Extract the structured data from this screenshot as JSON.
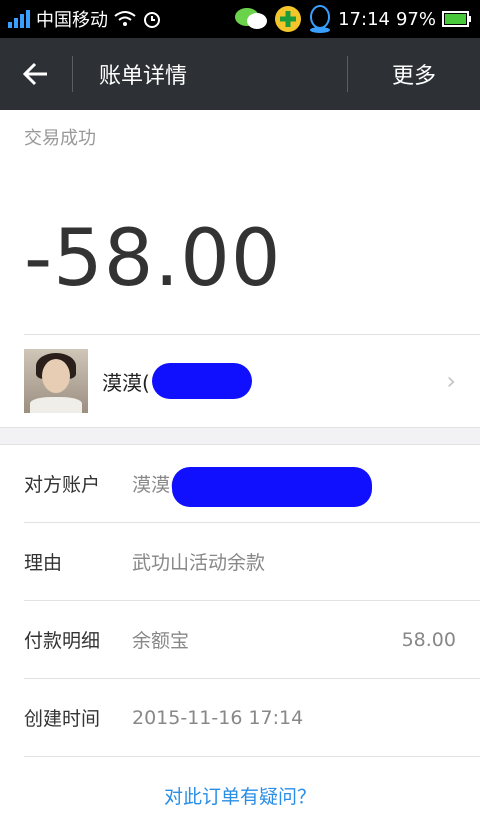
{
  "status_bar": {
    "carrier": "中国移动",
    "time": "17:14",
    "battery": "97%"
  },
  "header": {
    "title": "账单详情",
    "more_label": "更多"
  },
  "transaction": {
    "status": "交易成功",
    "amount": "-58.00",
    "counterparty_name": "漠漠("
  },
  "details": [
    {
      "label": "对方账户",
      "value": "漠漠(",
      "extra": ""
    },
    {
      "label": "理由",
      "value": "武功山活动余款",
      "extra": ""
    },
    {
      "label": "付款明细",
      "value": "余额宝",
      "extra": "58.00"
    },
    {
      "label": "创建时间",
      "value": "2015-11-16 17:14",
      "extra": ""
    }
  ],
  "dispute_link": "对此订单有疑问？",
  "colors": {
    "accent": "#2a8ee6",
    "appbar": "#2d3035"
  }
}
